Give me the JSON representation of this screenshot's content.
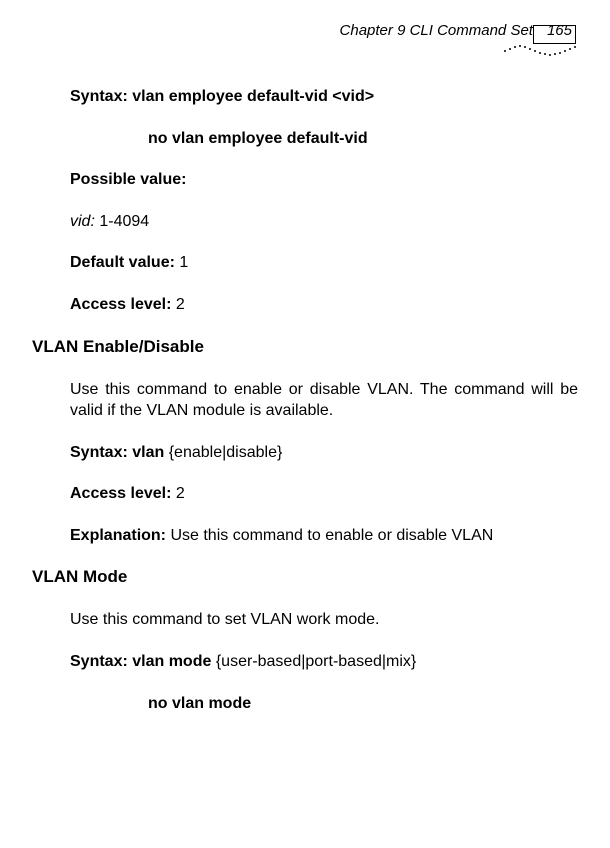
{
  "header": {
    "chapter": "Chapter 9 CLI Command Set",
    "page": "165"
  },
  "s1": {
    "syntax_label": "Syntax: vlan employee default-vid <vid>",
    "no_form": "no vlan employee default-vid",
    "pv_label": "Possible value:",
    "vid_key": "vid:",
    "vid_val": " 1-4094",
    "dv_label": "Default value:",
    "dv_val": " 1",
    "al_label": "Access level:",
    "al_val": " 2"
  },
  "s2": {
    "heading": "VLAN Enable/Disable",
    "desc": "Use this command to enable or disable VLAN. The command will be valid if the VLAN module is available.",
    "syn_label": "Syntax: vlan",
    "syn_rest": " {enable|disable}",
    "al_label": "Access level:",
    "al_val": " 2",
    "ex_label": "Explanation:",
    "ex_val": " Use this command to enable or disable VLAN"
  },
  "s3": {
    "heading": "VLAN Mode",
    "desc": "Use this command to set VLAN work mode.",
    "syn_label": "Syntax: vlan mode",
    "syn_rest": " {user-based|port-based|mix}",
    "no_form": "no vlan mode"
  }
}
